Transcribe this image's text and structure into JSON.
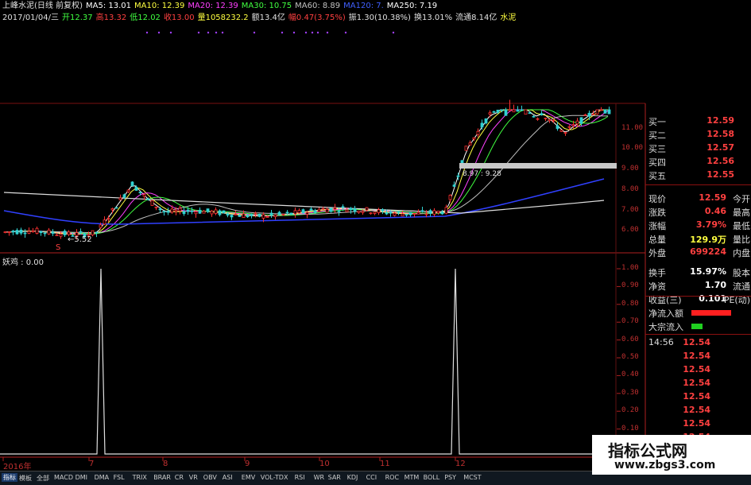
{
  "header": {
    "row1": [
      {
        "text": "上峰水泥(日线 前复权)",
        "color": "#e0e0e0"
      },
      {
        "text": "MA5: 13.01",
        "color": "#ffffff"
      },
      {
        "text": "MA10: 12.39",
        "color": "#ffff40"
      },
      {
        "text": "MA20: 12.39",
        "color": "#ff40ff"
      },
      {
        "text": "MA30: 10.75",
        "color": "#40ff40"
      },
      {
        "text": "MA60: 8.89",
        "color": "#c0c0c0"
      },
      {
        "text": "MA120: 7.",
        "color": "#4060ff"
      },
      {
        "text": "MA250: 7.19",
        "color": "#ffffff"
      }
    ],
    "row2": [
      {
        "text": "2017/01/04/三",
        "color": "#e0e0e0"
      },
      {
        "text": "开12.37",
        "color": "#40ff40"
      },
      {
        "text": "高13.32",
        "color": "#ff4040"
      },
      {
        "text": "低12.02",
        "color": "#40ff40"
      },
      {
        "text": "收13.00",
        "color": "#ff4040"
      },
      {
        "text": "量1058232.2",
        "color": "#ffff40"
      },
      {
        "text": "额13.4亿",
        "color": "#e0e0e0"
      },
      {
        "text": "幅0.47(3.75%)",
        "color": "#ff4040"
      },
      {
        "text": "振1.30(10.38%)",
        "color": "#e0e0e0"
      },
      {
        "text": "换13.01%",
        "color": "#e0e0e0"
      },
      {
        "text": "流通8.14亿",
        "color": "#e0e0e0"
      },
      {
        "text": "水泥",
        "color": "#ffff40"
      }
    ]
  },
  "main_chart": {
    "low_annotation": "←5.52",
    "signal_marker": "S",
    "box_label": "8.97 : 9.28",
    "y_ticks": [
      "11.00",
      "10.00",
      "9.00",
      "8.00",
      "7.00",
      "6.00"
    ]
  },
  "indicator": {
    "title": "妖鸡 : 0.00",
    "y_ticks": [
      "1.00",
      "0.90",
      "0.80",
      "0.70",
      "0.60",
      "0.50",
      "0.40",
      "0.30",
      "0.20",
      "0.10"
    ],
    "spikes_at_months": [
      "7",
      "12"
    ]
  },
  "x_axis": {
    "labels": [
      "2016年",
      "7",
      "8",
      "9",
      "10",
      "11",
      "12"
    ]
  },
  "sidebar": {
    "bids": [
      {
        "label": "买一",
        "value": "12.59"
      },
      {
        "label": "买二",
        "value": "12.58"
      },
      {
        "label": "买三",
        "value": "12.57"
      },
      {
        "label": "买四",
        "value": "12.56"
      },
      {
        "label": "买五",
        "value": "12.55"
      }
    ],
    "stats": [
      {
        "label": "现价",
        "value": "12.59",
        "extra": "今开",
        "color": "#ff4040"
      },
      {
        "label": "涨跌",
        "value": "0.46",
        "extra": "最高",
        "color": "#ff4040"
      },
      {
        "label": "涨幅",
        "value": "3.79%",
        "extra": "最低",
        "color": "#ff4040"
      },
      {
        "label": "总量",
        "value": "129.9万",
        "extra": "量比",
        "color": "#ffff40"
      },
      {
        "label": "外盘",
        "value": "699224",
        "extra": "内盘",
        "color": "#ff4040"
      },
      {
        "label": "换手",
        "value": "15.97%",
        "extra": "股本",
        "color": "#ffffff"
      },
      {
        "label": "净资",
        "value": "1.70",
        "extra": "流通",
        "color": "#ffffff"
      },
      {
        "label": "收益(三)",
        "value": "0.101",
        "extra": "PE(动)",
        "color": "#ffffff"
      }
    ],
    "flows": [
      {
        "label": "净流入额",
        "bar_color": "#ff2020",
        "fill": 0.9
      },
      {
        "label": "大宗流入",
        "bar_color": "#20d020",
        "fill": 0.25
      }
    ],
    "tick_time": "14:56",
    "ticks": [
      "12.54",
      "12.54",
      "12.54",
      "12.54",
      "12.54",
      "12.54",
      "12.54",
      "12.54",
      "12.54",
      "12.54",
      "12.54"
    ]
  },
  "tabs": [
    "指标",
    "模板",
    "全部",
    "MACD",
    "DMI",
    "DMA",
    "FSL",
    "TRIX",
    "BRAR",
    "CR",
    "VR",
    "OBV",
    "ASI",
    "EMV",
    "VOL-TDX",
    "RSI",
    "WR",
    "SAR",
    "KDJ",
    "CCI",
    "ROC",
    "MTM",
    "BOLL",
    "PSY",
    "MCST"
  ],
  "watermark": {
    "line1": "指标公式网",
    "line2": "www.zbgs3.com"
  }
}
